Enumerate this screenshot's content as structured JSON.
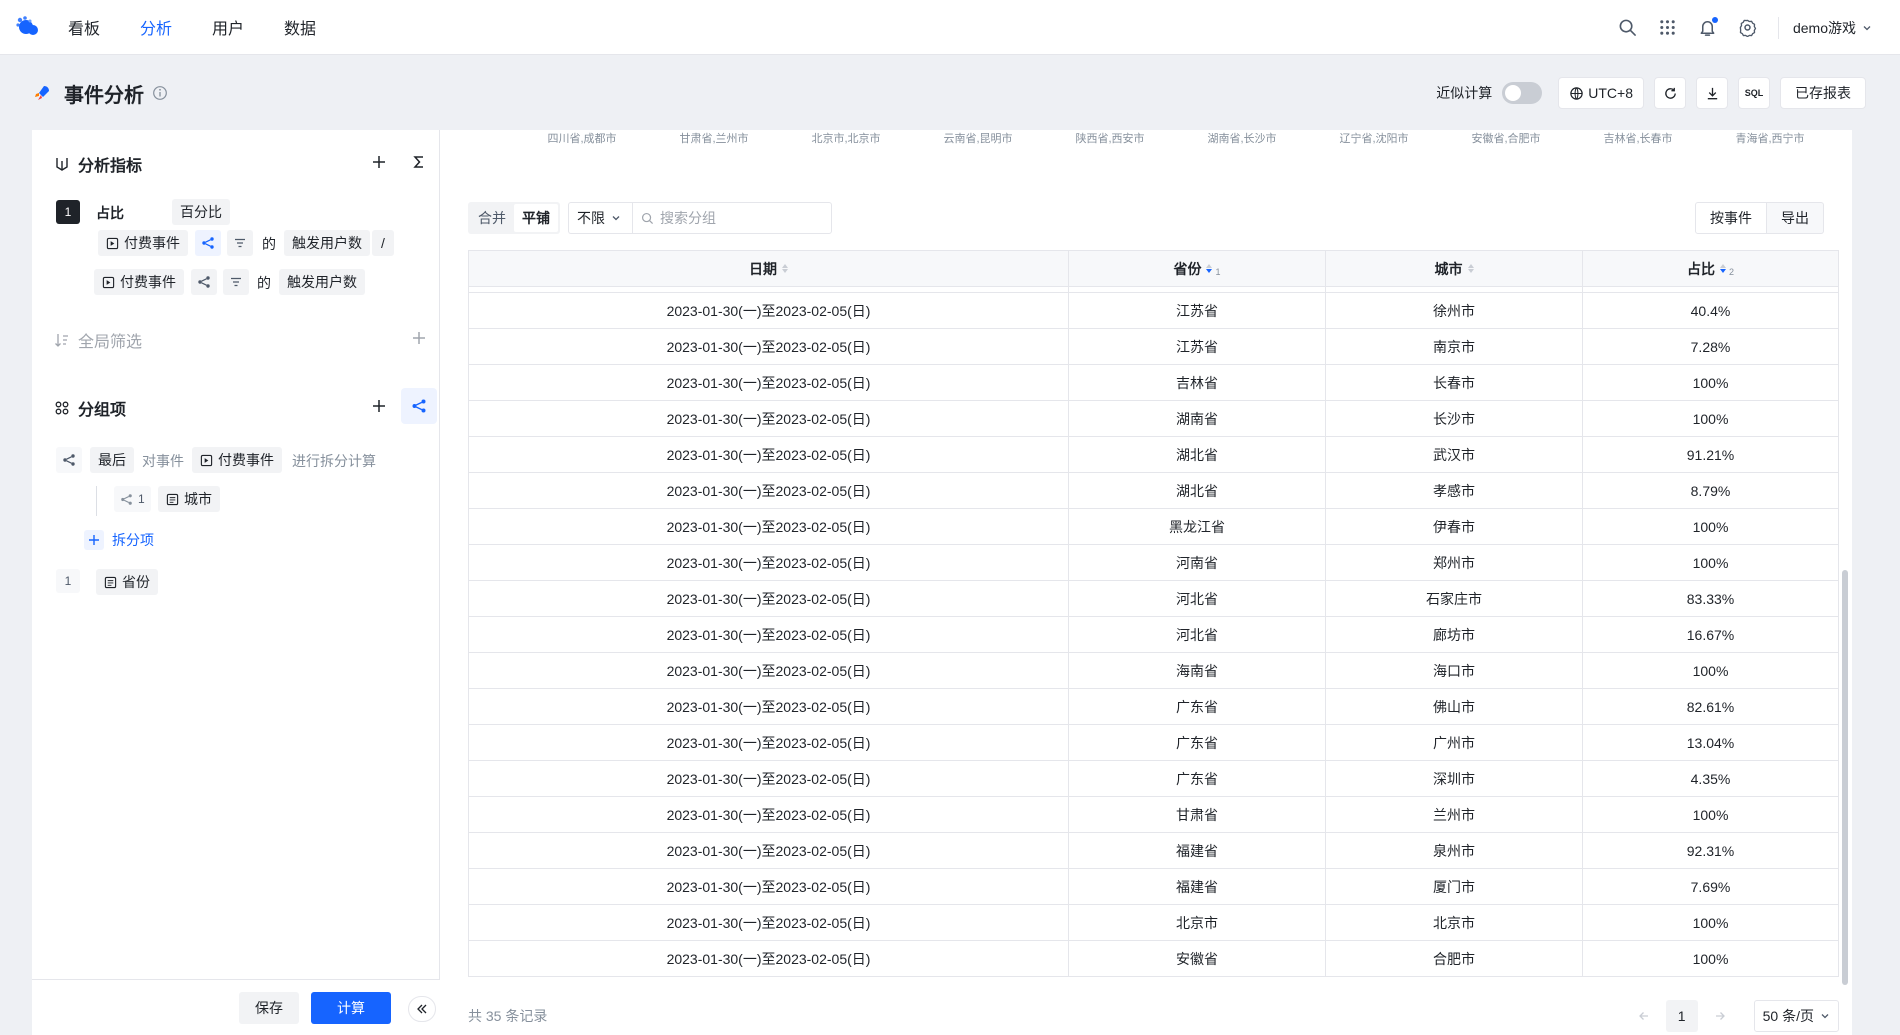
{
  "nav": {
    "items": [
      {
        "label": "看板",
        "active": false
      },
      {
        "label": "分析",
        "active": true
      },
      {
        "label": "用户",
        "active": false
      },
      {
        "label": "数据",
        "active": false
      }
    ],
    "user": "demo游戏"
  },
  "header": {
    "title": "事件分析",
    "approx_label": "近似计算",
    "approx_enabled": false,
    "timezone": "UTC+8",
    "sql_label": "SQL",
    "saved_reports": "已存报表"
  },
  "metrics": {
    "title": "分析指标",
    "index": "1",
    "name": "占比",
    "format": "百分比",
    "numerator": {
      "event": "付费事件",
      "of": "的",
      "measure": "触发用户数"
    },
    "divide_op": "/",
    "denominator": {
      "event": "付费事件",
      "of": "的",
      "measure": "触发用户数"
    }
  },
  "global_filter": {
    "title": "全局筛选"
  },
  "grouping": {
    "title": "分组项",
    "split": {
      "mode": "最后",
      "prefix": "对事件",
      "event": "付费事件",
      "suffix": "进行拆分计算"
    },
    "sub_index": "1",
    "sub_property": "城市",
    "add_split": "拆分项",
    "group_index": "1",
    "group_property": "省份"
  },
  "actions": {
    "save": "保存",
    "calc": "计算"
  },
  "chart_axis_labels": [
    "四川省,成都市",
    "甘肃省,兰州市",
    "北京市,北京市",
    "云南省,昆明市",
    "陕西省,西安市",
    "湖南省,长沙市",
    "辽宁省,沈阳市",
    "安徽省,合肥市",
    "吉林省,长春市",
    "青海省,西宁市"
  ],
  "toolbar": {
    "merge": "合并",
    "tile": "平铺",
    "filter_value": "不限",
    "search_placeholder": "搜索分组",
    "by_event": "按事件",
    "export": "导出"
  },
  "table": {
    "columns": [
      {
        "label": "日期",
        "sort_order": ""
      },
      {
        "label": "省份",
        "sort_order": "1"
      },
      {
        "label": "城市",
        "sort_order": ""
      },
      {
        "label": "占比",
        "sort_order": "2"
      }
    ],
    "rows": [
      {
        "date": "2023-01-30(一)至2023-02-05(日)",
        "province": "江苏省",
        "city": "徐州市",
        "pct": "40.4%"
      },
      {
        "date": "2023-01-30(一)至2023-02-05(日)",
        "province": "江苏省",
        "city": "南京市",
        "pct": "7.28%"
      },
      {
        "date": "2023-01-30(一)至2023-02-05(日)",
        "province": "吉林省",
        "city": "长春市",
        "pct": "100%"
      },
      {
        "date": "2023-01-30(一)至2023-02-05(日)",
        "province": "湖南省",
        "city": "长沙市",
        "pct": "100%"
      },
      {
        "date": "2023-01-30(一)至2023-02-05(日)",
        "province": "湖北省",
        "city": "武汉市",
        "pct": "91.21%"
      },
      {
        "date": "2023-01-30(一)至2023-02-05(日)",
        "province": "湖北省",
        "city": "孝感市",
        "pct": "8.79%"
      },
      {
        "date": "2023-01-30(一)至2023-02-05(日)",
        "province": "黑龙江省",
        "city": "伊春市",
        "pct": "100%"
      },
      {
        "date": "2023-01-30(一)至2023-02-05(日)",
        "province": "河南省",
        "city": "郑州市",
        "pct": "100%"
      },
      {
        "date": "2023-01-30(一)至2023-02-05(日)",
        "province": "河北省",
        "city": "石家庄市",
        "pct": "83.33%"
      },
      {
        "date": "2023-01-30(一)至2023-02-05(日)",
        "province": "河北省",
        "city": "廊坊市",
        "pct": "16.67%"
      },
      {
        "date": "2023-01-30(一)至2023-02-05(日)",
        "province": "海南省",
        "city": "海口市",
        "pct": "100%"
      },
      {
        "date": "2023-01-30(一)至2023-02-05(日)",
        "province": "广东省",
        "city": "佛山市",
        "pct": "82.61%"
      },
      {
        "date": "2023-01-30(一)至2023-02-05(日)",
        "province": "广东省",
        "city": "广州市",
        "pct": "13.04%"
      },
      {
        "date": "2023-01-30(一)至2023-02-05(日)",
        "province": "广东省",
        "city": "深圳市",
        "pct": "4.35%"
      },
      {
        "date": "2023-01-30(一)至2023-02-05(日)",
        "province": "甘肃省",
        "city": "兰州市",
        "pct": "100%"
      },
      {
        "date": "2023-01-30(一)至2023-02-05(日)",
        "province": "福建省",
        "city": "泉州市",
        "pct": "92.31%"
      },
      {
        "date": "2023-01-30(一)至2023-02-05(日)",
        "province": "福建省",
        "city": "厦门市",
        "pct": "7.69%"
      },
      {
        "date": "2023-01-30(一)至2023-02-05(日)",
        "province": "北京市",
        "city": "北京市",
        "pct": "100%"
      },
      {
        "date": "2023-01-30(一)至2023-02-05(日)",
        "province": "安徽省",
        "city": "合肥市",
        "pct": "100%"
      }
    ]
  },
  "pagination": {
    "total_text": "共 35 条记录",
    "current_page": "1",
    "page_size": "50 条/页"
  },
  "colors": {
    "accent": "#1664ff",
    "text": "#1f2329",
    "muted": "#86909c",
    "bg": "#eef0f4"
  }
}
